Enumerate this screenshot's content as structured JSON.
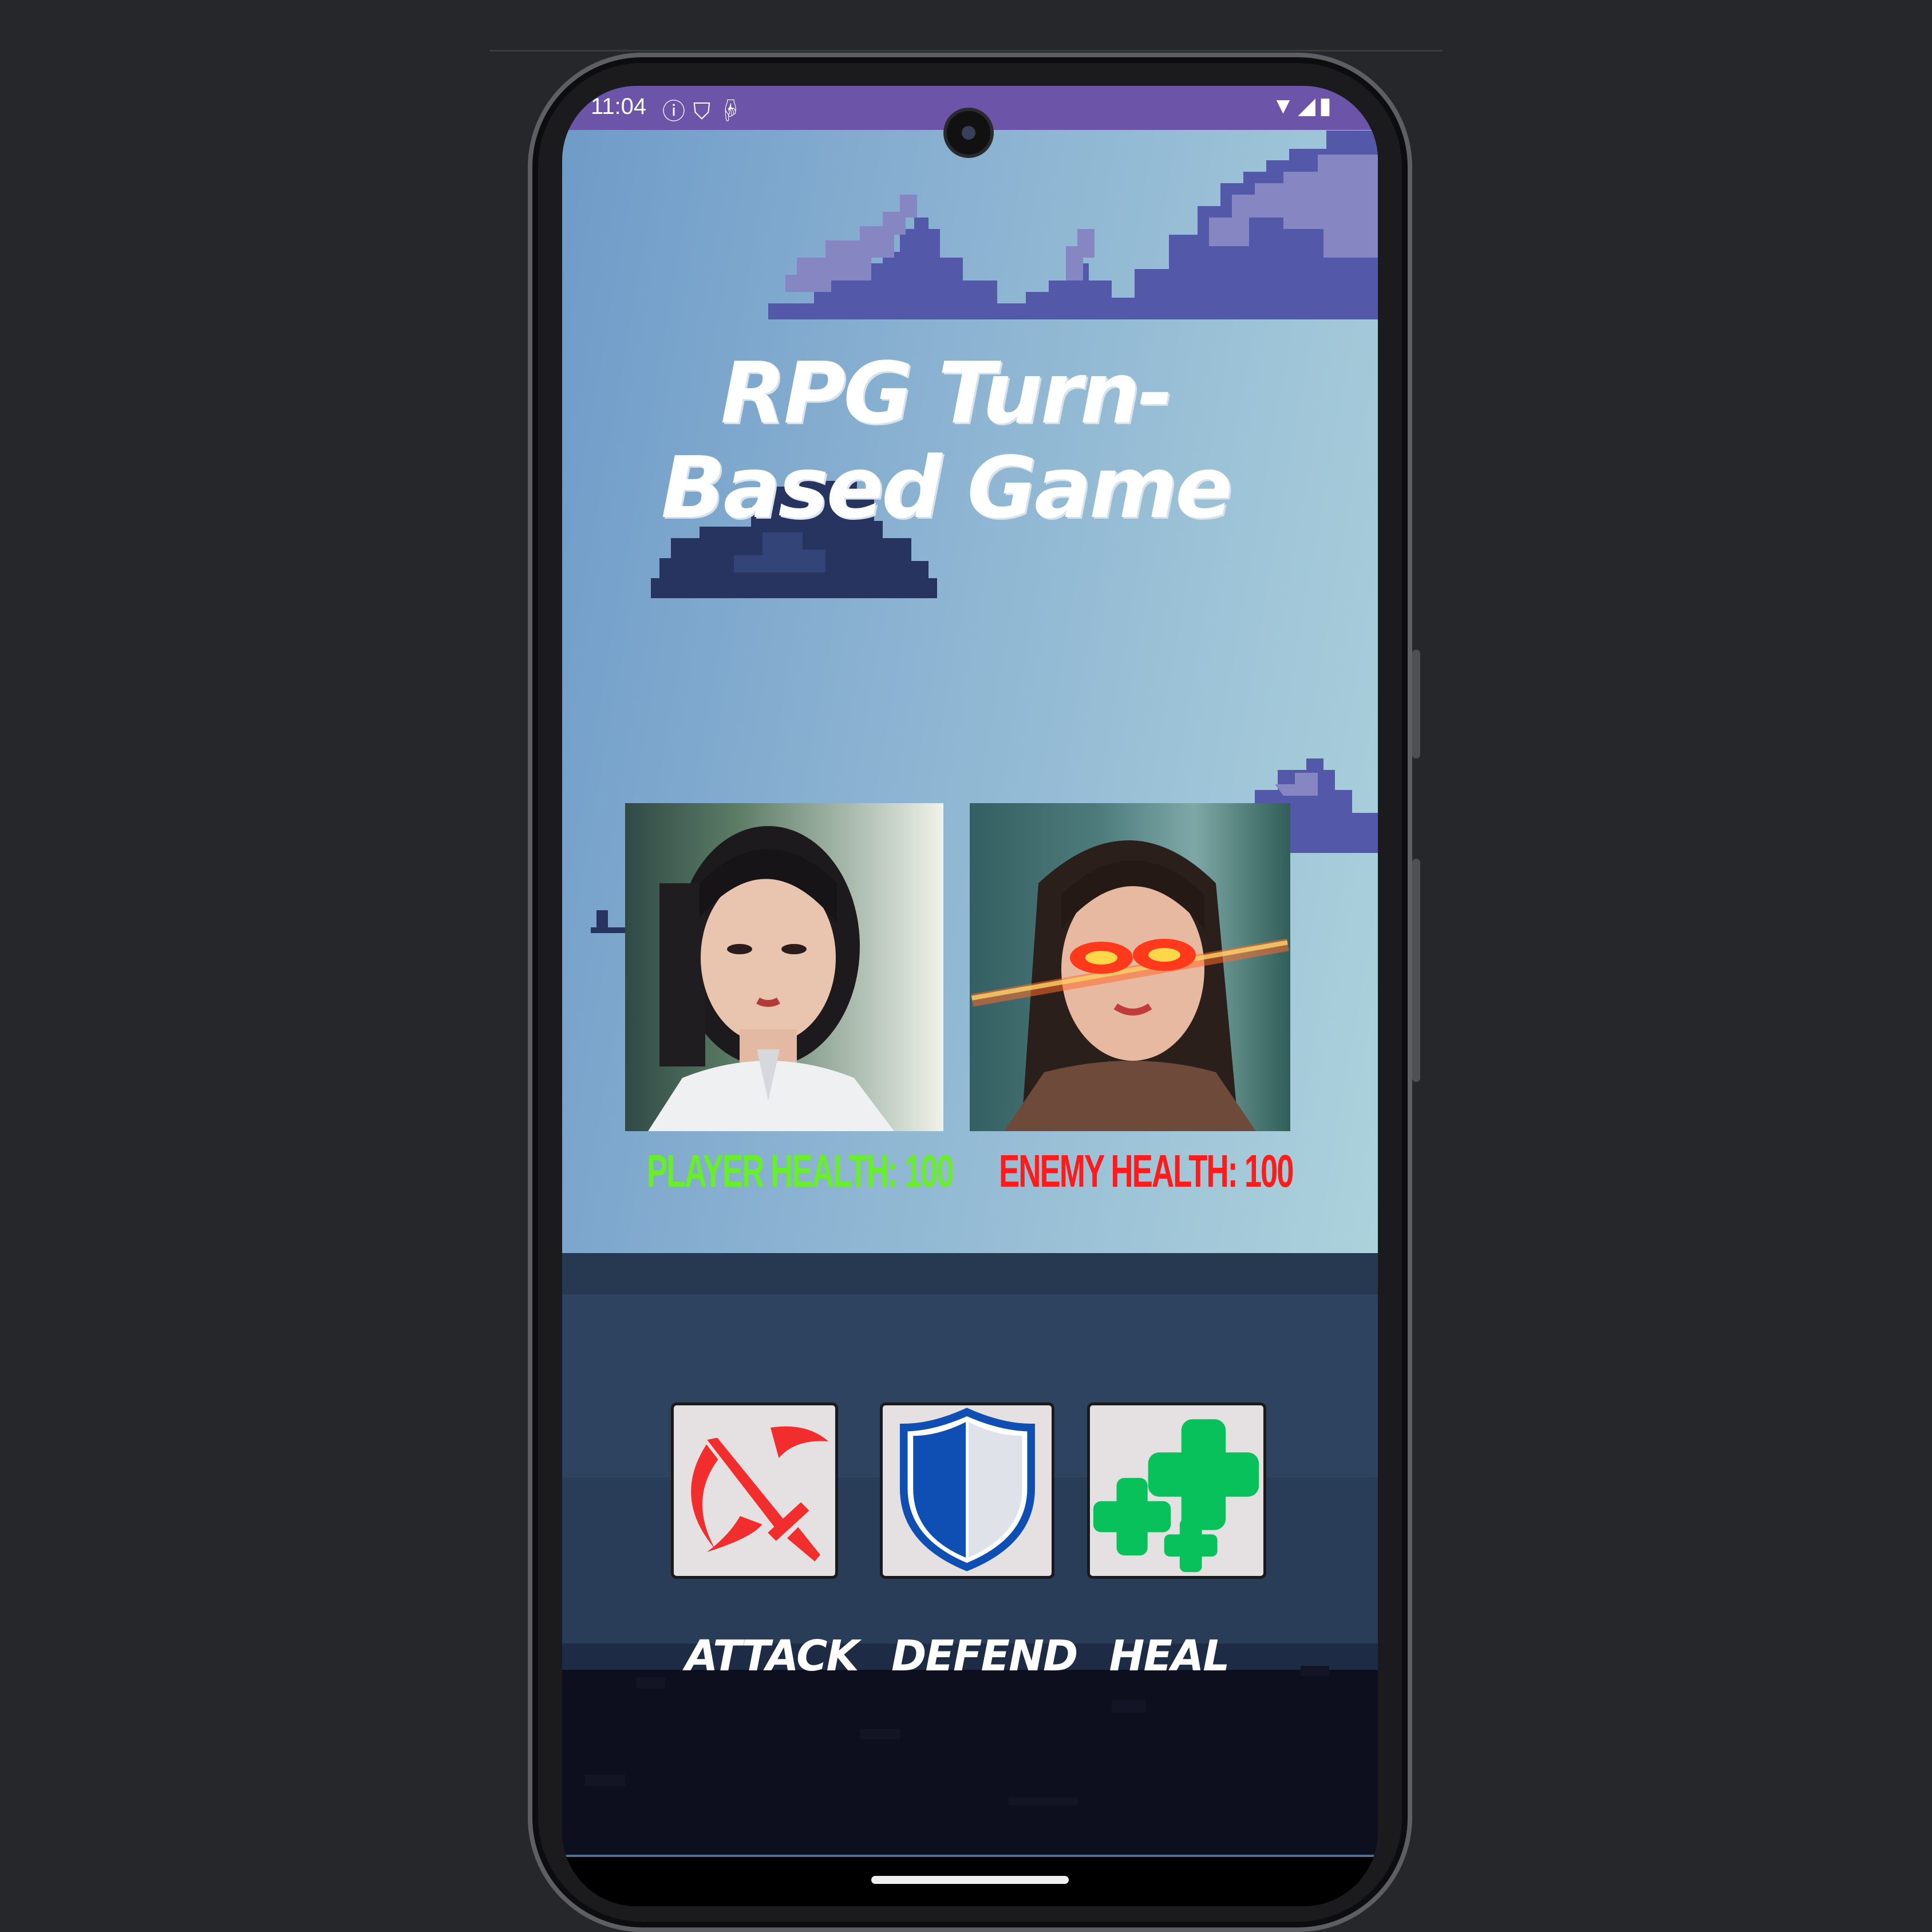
{
  "status_bar": {
    "time": "11:04",
    "left_icons": [
      "info-icon",
      "shield-icon",
      "accessibility-icon"
    ],
    "right_icons": [
      "wifi-icon",
      "signal-icon",
      "battery-icon"
    ]
  },
  "game": {
    "title": "RPG Turn-Based Game",
    "player": {
      "portrait": "player-portrait",
      "health_text": "PLAYER HEALTH: 100",
      "health": 100
    },
    "enemy": {
      "portrait": "enemy-portrait",
      "health_text": "ENEMY HEALTH: 100",
      "health": 100
    },
    "actions": [
      {
        "id": "attack",
        "label": "ATTACK",
        "icon": "sword-crescent-icon"
      },
      {
        "id": "defend",
        "label": "DEFEND",
        "icon": "shield-icon"
      },
      {
        "id": "heal",
        "label": "HEAL",
        "icon": "health-crosses-icon"
      }
    ]
  },
  "colors": {
    "status_bar": "#6c54a8",
    "player_health": "#69ee2a",
    "enemy_health": "#ff1b1b",
    "attack_icon": "#f12d2d",
    "defend_icon": "#0f4fb3",
    "heal_icon": "#09c15a"
  }
}
